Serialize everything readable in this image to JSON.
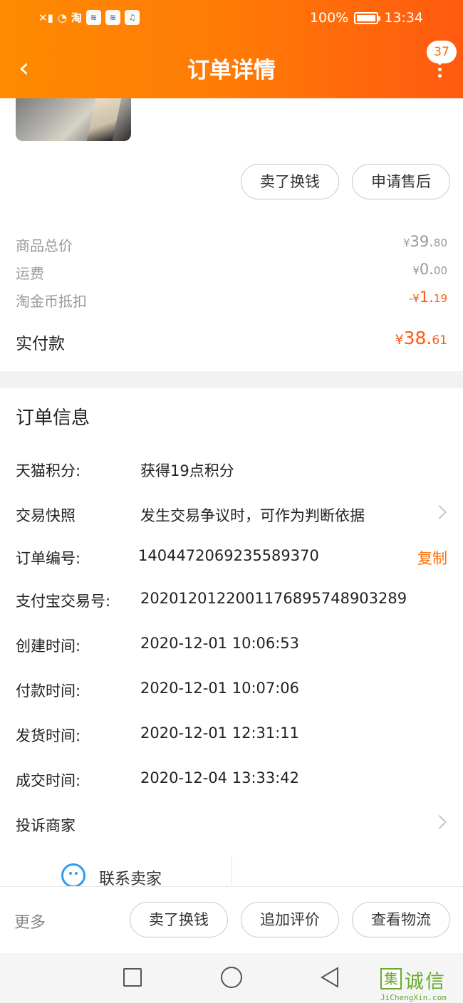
{
  "status_bar": {
    "carrier_icons": [
      "signal-off-icon",
      "wifi-icon",
      "taobao-notify-icon",
      "wifi-app-icon",
      "wifi-app-icon-2",
      "music-icon"
    ],
    "taobao_glyph": "淘",
    "battery_text": "100%",
    "battery_level": 1.0,
    "time": "13:34"
  },
  "header": {
    "back_icon": "chevron-left-icon",
    "title": "订单详情",
    "more_icon": "more-vertical-icon",
    "badge_count": "37"
  },
  "product_actions": {
    "sell_label": "卖了换钱",
    "after_sale_label": "申请售后"
  },
  "price_summary": {
    "goods_total": {
      "label": "商品总价",
      "yen": "¥",
      "int": "39.",
      "dec": "80"
    },
    "shipping": {
      "label": "运费",
      "yen": "¥",
      "int": "0.",
      "dec": "00"
    },
    "coin_deduct": {
      "label": "淘金币抵扣",
      "yen": "-¥",
      "int": "1.",
      "dec": "19"
    },
    "paid": {
      "label": "实付款",
      "yen": "¥",
      "int": "38.",
      "dec": "61"
    }
  },
  "order_info": {
    "title": "订单信息",
    "points": {
      "label": "天猫积分:",
      "value": "获得19点积分"
    },
    "snapshot": {
      "label": "交易快照",
      "value": "发生交易争议时，可作为判断依据"
    },
    "order_no": {
      "label": "订单编号:",
      "value": "1404472069235589370",
      "copy": "复制"
    },
    "alipay_no": {
      "label": "支付宝交易号:",
      "value": "2020120122001176895748903289"
    },
    "created": {
      "label": "创建时间:",
      "value": "2020-12-01 10:06:53"
    },
    "paid_time": {
      "label": "付款时间:",
      "value": "2020-12-01 10:07:06"
    },
    "shipped": {
      "label": "发货时间:",
      "value": "2020-12-01 12:31:11"
    },
    "completed": {
      "label": "成交时间:",
      "value": "2020-12-04 13:33:42"
    },
    "complaint": {
      "label": "投诉商家"
    }
  },
  "contact": {
    "icon": "chat-smile-icon",
    "label": "联系卖家"
  },
  "bottom_bar": {
    "more": "更多",
    "sell": "卖了换钱",
    "review": "追加评价",
    "logistics": "查看物流"
  },
  "system_nav": {
    "recent_icon": "square-icon",
    "home_icon": "circle-icon",
    "back_icon": "triangle-back-icon"
  },
  "watermark": {
    "box_char": "集",
    "text": "诚信",
    "url": "JiChengXin.com"
  },
  "colors": {
    "header_start": "#ff8a00",
    "header_end": "#ff5a10",
    "accent_orange": "#ff5a10",
    "muted_text": "#999999",
    "contact_blue": "#2d9cf0",
    "watermark_green": "#6aaa2e"
  }
}
